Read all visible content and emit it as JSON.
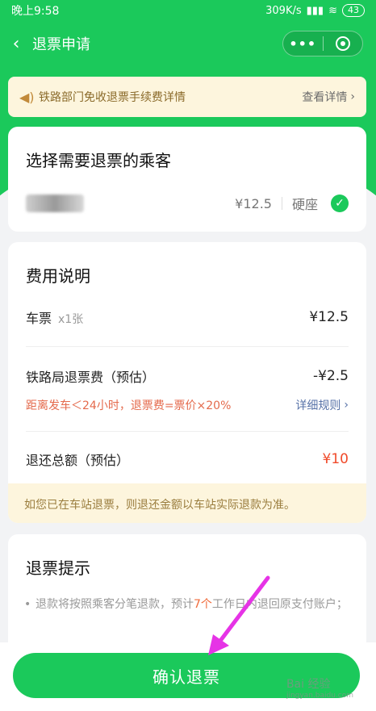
{
  "status_bar": {
    "time": "晚上9:58",
    "network_speed": "309K/s",
    "battery": "43"
  },
  "nav": {
    "back_icon": "chevron-left-icon",
    "title": "退票申请",
    "more_icon": "more-dots-icon",
    "close_icon": "target-circle-icon"
  },
  "notice": {
    "icon": "speaker-icon",
    "text": "铁路部门免收退票手续费详情",
    "link": "查看详情"
  },
  "passenger_card": {
    "title": "选择需要退票的乘客",
    "price": "¥12.5",
    "seat": "硬座",
    "selected": true
  },
  "fee_card": {
    "title": "费用说明",
    "ticket_label": "车票",
    "ticket_count": "x1张",
    "ticket_price": "¥12.5",
    "fee_label": "铁路局退票费（预估）",
    "fee_value": "-¥2.5",
    "rule_text": "距离发车＜24小时，退票费=票价×20%",
    "rule_link": "详细规则",
    "refund_label": "退还总额（预估）",
    "refund_value": "¥10",
    "station_tip": "如您已在车站退票，则退还金额以车站实际退款为准。"
  },
  "tips_card": {
    "title": "退票提示",
    "item_before": "退款将按照乘客分笔退款，预计",
    "item_highlight": "7个",
    "item_after": "工作日内退回原支付账户；"
  },
  "confirm_button": "确认退票",
  "watermark": {
    "brand": "Bai 经验",
    "url": "jingyan.baidu.com"
  },
  "colors": {
    "brand_green": "#1bc95b",
    "warning_red": "#f04a2a",
    "annotation_arrow": "#e633e6"
  }
}
